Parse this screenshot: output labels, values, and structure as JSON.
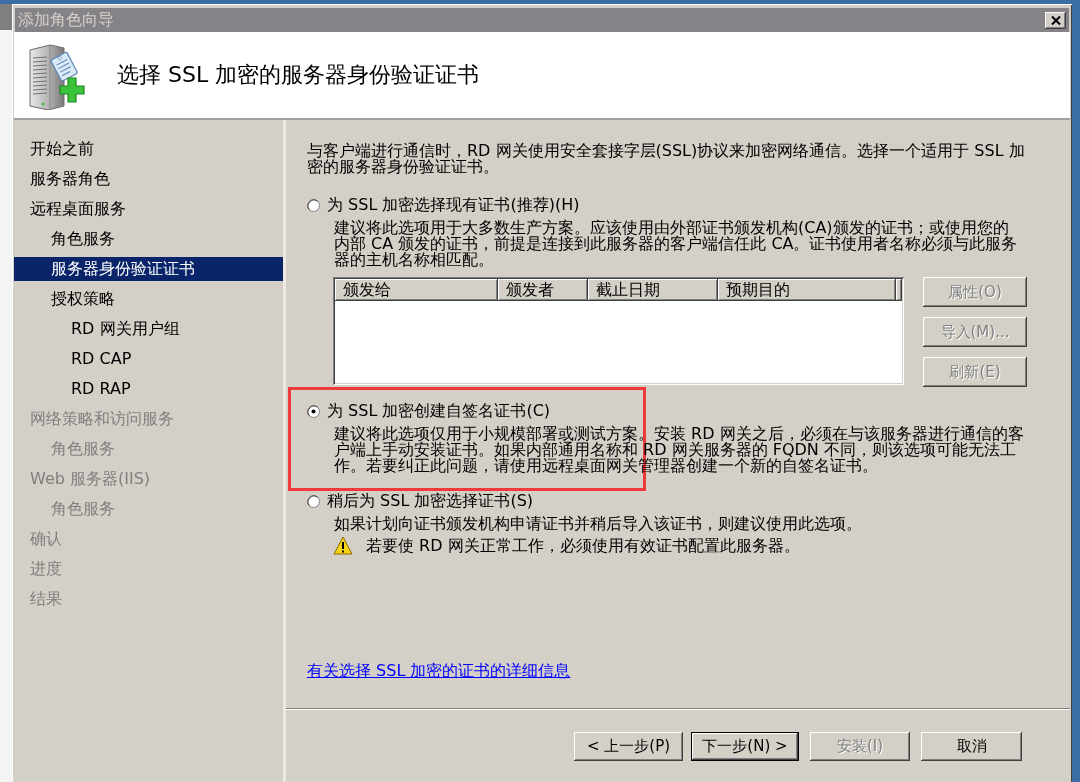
{
  "window": {
    "title": "添加角色向导"
  },
  "header": {
    "title": "选择 SSL 加密的服务器身份验证证书"
  },
  "sidebar": {
    "items": [
      {
        "label": "开始之前",
        "selected": false,
        "disabled": false
      },
      {
        "label": "服务器角色",
        "selected": false,
        "disabled": false
      },
      {
        "label": "远程桌面服务",
        "selected": false,
        "disabled": false,
        "children": [
          {
            "label": "角色服务",
            "selected": false,
            "disabled": false
          },
          {
            "label": "服务器身份验证证书",
            "selected": true,
            "disabled": false
          },
          {
            "label": "授权策略",
            "selected": false,
            "disabled": false,
            "children": [
              {
                "label": "RD 网关用户组",
                "selected": false,
                "disabled": false
              },
              {
                "label": "RD CAP",
                "selected": false,
                "disabled": false
              },
              {
                "label": "RD RAP",
                "selected": false,
                "disabled": false
              }
            ]
          }
        ]
      },
      {
        "label": "网络策略和访问服务",
        "selected": false,
        "disabled": true,
        "children": [
          {
            "label": "角色服务",
            "selected": false,
            "disabled": true
          }
        ]
      },
      {
        "label": "Web 服务器(IIS)",
        "selected": false,
        "disabled": true,
        "children": [
          {
            "label": "角色服务",
            "selected": false,
            "disabled": true
          }
        ]
      },
      {
        "label": "确认",
        "selected": false,
        "disabled": true
      },
      {
        "label": "进度",
        "selected": false,
        "disabled": true
      },
      {
        "label": "结果",
        "selected": false,
        "disabled": true
      }
    ]
  },
  "intro": "与客户端进行通信时，RD 网关使用安全套接字层(SSL)协议来加密网络通信。选择一个适用于 SSL 加密的服务器身份验证证书。",
  "options": [
    {
      "label": "为 SSL 加密选择现有证书(推荐)(H)",
      "selected": false,
      "highlighted": false,
      "description": "建议将此选项用于大多数生产方案。应该使用由外部证书颁发机构(CA)颁发的证书；或使用您的内部 CA 颁发的证书，前提是连接到此服务器的客户端信任此 CA。证书使用者名称必须与此服务器的主机名称相匹配。",
      "certificates": {
        "columns": [
          "颁发给",
          "颁发者",
          "截止日期",
          "预期目的"
        ],
        "buttons": [
          {
            "label": "属性(O)",
            "disabled": true
          },
          {
            "label": "导入(M)...",
            "disabled": true
          },
          {
            "label": "刷新(E)",
            "disabled": true
          }
        ]
      }
    },
    {
      "label": "为 SSL 加密创建自签名证书(C)",
      "selected": true,
      "highlighted": true,
      "description": "建议将此选项仅用于小规模部署或测试方案。安装 RD 网关之后，必须在与该服务器进行通信的客户端上手动安装证书。如果内部通用名称和 RD 网关服务器的 FQDN 不同，则该选项可能无法工作。若要纠正此问题，请使用远程桌面网关管理器创建一个新的自签名证书。"
    },
    {
      "label": "稍后为 SSL 加密选择证书(S)",
      "selected": false,
      "highlighted": false,
      "description": "如果计划向证书颁发机构申请证书并稍后导入该证书，则建议使用此选项。",
      "warning": "若要使 RD 网关正常工作，必须使用有效证书配置此服务器。"
    }
  ],
  "link": "有关选择 SSL 加密的证书的详细信息",
  "footer_buttons": [
    {
      "label": "< 上一步(P)",
      "disabled": false,
      "default": false
    },
    {
      "label": "下一步(N) >",
      "disabled": false,
      "default": true
    },
    {
      "label": "安装(I)",
      "disabled": true,
      "default": false
    },
    {
      "label": "取消",
      "disabled": false,
      "default": false
    }
  ]
}
